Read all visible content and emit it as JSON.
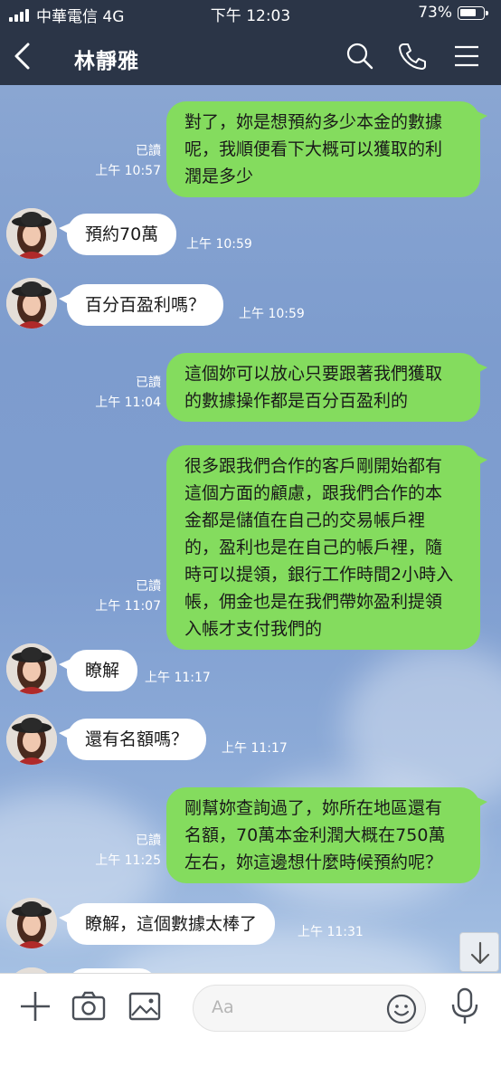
{
  "status_bar": {
    "carrier": "中華電信 4G",
    "time": "下午 12:03",
    "battery": "73%",
    "battery_level": 0.73
  },
  "header": {
    "contact_name": "林靜雅",
    "icons": [
      "back-chevron-icon",
      "search-icon",
      "phone-icon",
      "menu-icon"
    ]
  },
  "messages": [
    {
      "dir": "out",
      "lines": [
        "對了，妳是想預約多少本金的數據",
        "呢，我順便看下大概可以獲取的利",
        "潤是多少"
      ],
      "read": "已讀",
      "time": "上午 10:57"
    },
    {
      "dir": "in",
      "lines": [
        "預約70萬"
      ],
      "time": "上午 10:59"
    },
    {
      "dir": "in",
      "lines": [
        "百分百盈利嗎？"
      ],
      "time": "上午 10:59"
    },
    {
      "dir": "out",
      "lines": [
        "這個妳可以放心只要跟著我們獲取",
        "的數據操作都是百分百盈利的"
      ],
      "read": "已讀",
      "time": "上午 11:04"
    },
    {
      "dir": "out",
      "lines": [
        "很多跟我們合作的客戶剛開始都有",
        "這個方面的顧慮，跟我們合作的本",
        "金都是儲值在自己的交易帳戶裡",
        "的，盈利也是在自己的帳戶裡，隨",
        "時可以提領，銀行工作時間2小時入",
        "帳，佣金也是在我們帶妳盈利提領",
        "入帳才支付我們的"
      ],
      "read": "已讀",
      "time": "上午 11:07"
    },
    {
      "dir": "in",
      "lines": [
        "瞭解"
      ],
      "time": "上午 11:17"
    },
    {
      "dir": "in",
      "lines": [
        "還有名額嗎？"
      ],
      "time": "上午 11:17"
    },
    {
      "dir": "out",
      "lines": [
        "剛幫妳查詢過了，妳所在地區還有",
        "名額，70萬本金利潤大概在750萬",
        "左右，妳這邊想什麼時候預約呢？"
      ],
      "read": "已讀",
      "time": "上午 11:25"
    },
    {
      "dir": "in",
      "lines": [
        "瞭解，這個數據太棒了"
      ],
      "time": "上午 11:31"
    }
  ],
  "input_bar": {
    "placeholder": "Aa",
    "icons": [
      "plus-icon",
      "camera-icon",
      "image-icon",
      "emoji-icon",
      "microphone-icon"
    ]
  },
  "colors": {
    "header_bg": "#2b3547",
    "outgoing_bubble": "#84dc5e",
    "incoming_bubble": "#ffffff",
    "chat_bg": "#7f9ed0"
  }
}
